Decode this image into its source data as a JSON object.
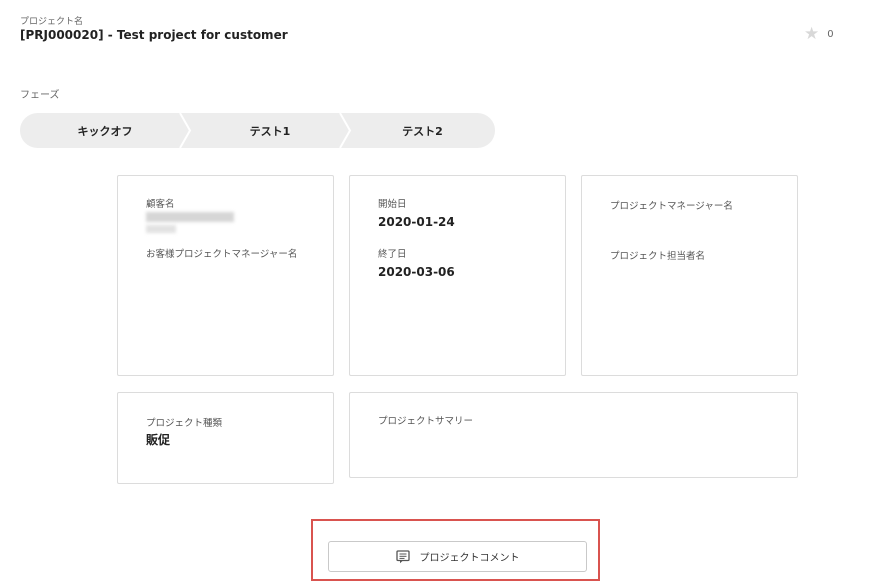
{
  "header": {
    "project_label": "プロジェクト名",
    "project_title": "[PRJ000020] - Test project for customer",
    "favorite_count": "0"
  },
  "phases": {
    "label": "フェーズ",
    "items": [
      "キックオフ",
      "テスト1",
      "テスト2"
    ]
  },
  "customer_card": {
    "customer_label": "顧客名",
    "customer_pm_label": "お客様プロジェクトマネージャー名"
  },
  "dates_card": {
    "start_label": "開始日",
    "start_value": "2020-01-24",
    "end_label": "終了日",
    "end_value": "2020-03-06"
  },
  "pm_card": {
    "pm_label": "プロジェクトマネージャー名",
    "owner_label": "プロジェクト担当者名"
  },
  "type_card": {
    "type_label": "プロジェクト種類",
    "type_value": "販促"
  },
  "summary_card": {
    "summary_label": "プロジェクトサマリー"
  },
  "comment_button": {
    "label": "プロジェクトコメント",
    "icon": "comment-icon"
  },
  "colors": {
    "highlight": "#d9534f",
    "phase_bg": "#ededed",
    "card_border": "#dcdcdc"
  }
}
